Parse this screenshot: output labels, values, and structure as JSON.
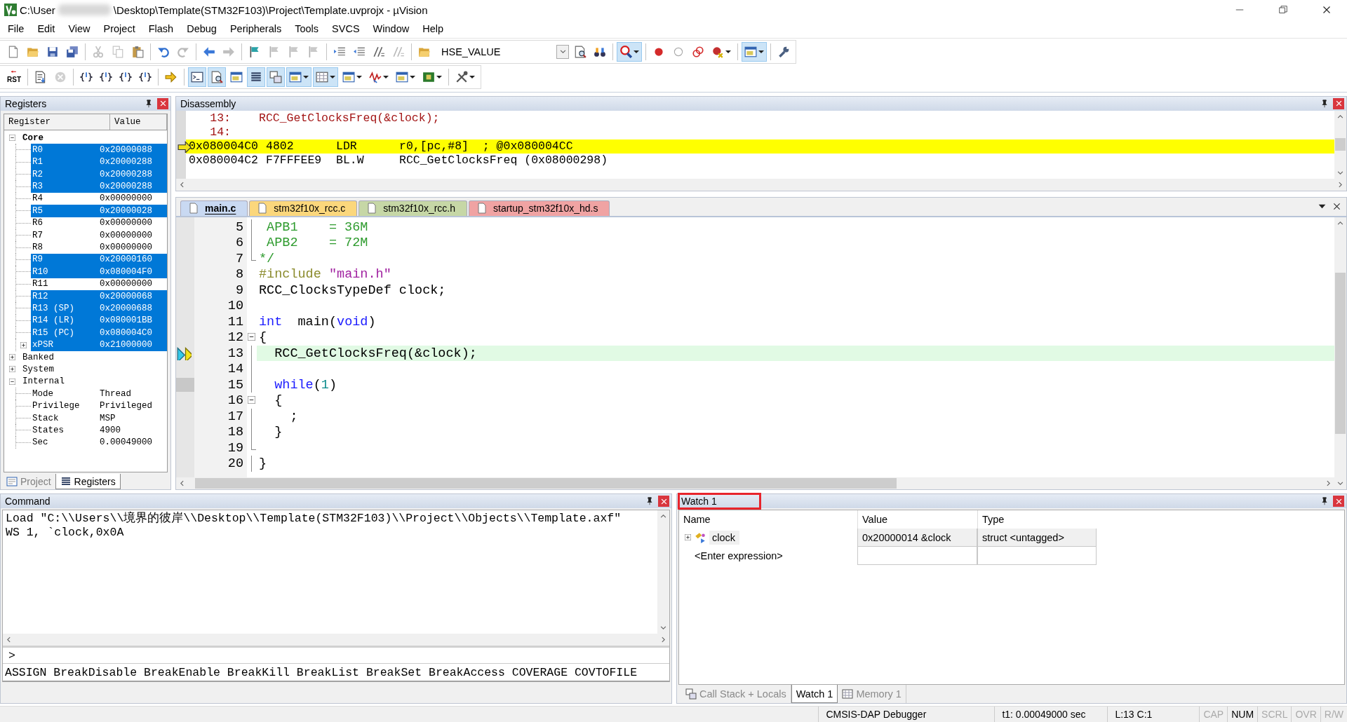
{
  "window": {
    "title_start": "C:\\User",
    "title_end": "\\Desktop\\Template(STM32F103)\\Project\\Template.uvprojx - µVision"
  },
  "menu": [
    "File",
    "Edit",
    "View",
    "Project",
    "Flash",
    "Debug",
    "Peripherals",
    "Tools",
    "SVCS",
    "Window",
    "Help"
  ],
  "toolbar_1": [
    {
      "kind": "button",
      "pressed": false,
      "disabled": false,
      "dropdown": false
    },
    {
      "kind": "button",
      "pressed": false,
      "disabled": false,
      "dropdown": false
    },
    {
      "kind": "button",
      "pressed": false,
      "disabled": false,
      "dropdown": false
    },
    {
      "kind": "button",
      "pressed": false,
      "disabled": false,
      "dropdown": false
    },
    {
      "kind": "separator"
    },
    {
      "kind": "button",
      "pressed": false,
      "disabled": true,
      "dropdown": false
    },
    {
      "kind": "button",
      "pressed": false,
      "disabled": true,
      "dropdown": false
    },
    {
      "kind": "button",
      "pressed": false,
      "disabled": false,
      "dropdown": false
    },
    {
      "kind": "separator"
    },
    {
      "kind": "button",
      "pressed": false,
      "disabled": false,
      "dropdown": false
    },
    {
      "kind": "button",
      "pressed": false,
      "disabled": true,
      "dropdown": false
    },
    {
      "kind": "separator"
    },
    {
      "kind": "button",
      "pressed": false,
      "disabled": false,
      "dropdown": false
    },
    {
      "kind": "button",
      "pressed": false,
      "disabled": true,
      "dropdown": false
    },
    {
      "kind": "separator"
    },
    {
      "kind": "button",
      "pressed": false,
      "disabled": false,
      "dropdown": false
    },
    {
      "kind": "button",
      "pressed": false,
      "disabled": true,
      "dropdown": false
    },
    {
      "kind": "button",
      "pressed": false,
      "disabled": true,
      "dropdown": false
    },
    {
      "kind": "button",
      "pressed": false,
      "disabled": true,
      "dropdown": false
    },
    {
      "kind": "separator"
    },
    {
      "kind": "button",
      "pressed": false,
      "disabled": false,
      "dropdown": false
    },
    {
      "kind": "button",
      "pressed": false,
      "disabled": false,
      "dropdown": false
    },
    {
      "kind": "button",
      "pressed": false,
      "disabled": false,
      "dropdown": false
    },
    {
      "kind": "button",
      "pressed": false,
      "disabled": true,
      "dropdown": false
    },
    {
      "kind": "separator"
    },
    {
      "kind": "button",
      "pressed": false,
      "disabled": false,
      "dropdown": false
    },
    {
      "kind": "combo",
      "value": "HSE_VALUE"
    },
    {
      "kind": "button",
      "pressed": false,
      "disabled": false,
      "dropdown": false
    },
    {
      "kind": "button",
      "pressed": false,
      "disabled": false,
      "dropdown": false
    },
    {
      "kind": "separator"
    },
    {
      "kind": "button",
      "pressed": true,
      "disabled": false,
      "dropdown": true
    },
    {
      "kind": "separator"
    },
    {
      "kind": "button",
      "pressed": false,
      "disabled": false,
      "dropdown": false
    },
    {
      "kind": "button",
      "pressed": false,
      "disabled": false,
      "dropdown": false
    },
    {
      "kind": "button",
      "pressed": false,
      "disabled": false,
      "dropdown": false
    },
    {
      "kind": "button",
      "pressed": false,
      "disabled": false,
      "dropdown": true
    },
    {
      "kind": "separator"
    },
    {
      "kind": "button",
      "pressed": true,
      "disabled": false,
      "dropdown": true
    },
    {
      "kind": "separator"
    },
    {
      "kind": "button",
      "pressed": false,
      "disabled": false,
      "dropdown": false
    }
  ],
  "toolbar_2": [
    {
      "kind": "button",
      "label": "RST",
      "pressed": false,
      "disabled": false,
      "dropdown": false
    },
    {
      "kind": "separator"
    },
    {
      "kind": "button",
      "pressed": false,
      "disabled": false,
      "dropdown": false
    },
    {
      "kind": "button",
      "pressed": false,
      "disabled": true,
      "dropdown": false
    },
    {
      "kind": "separator"
    },
    {
      "kind": "button",
      "pressed": false,
      "disabled": false,
      "dropdown": false
    },
    {
      "kind": "button",
      "pressed": false,
      "disabled": false,
      "dropdown": false
    },
    {
      "kind": "button",
      "pressed": false,
      "disabled": false,
      "dropdown": false
    },
    {
      "kind": "button",
      "pressed": false,
      "disabled": false,
      "dropdown": false
    },
    {
      "kind": "separator"
    },
    {
      "kind": "button",
      "pressed": false,
      "disabled": false,
      "dropdown": false
    },
    {
      "kind": "separator"
    },
    {
      "kind": "button",
      "pressed": true,
      "disabled": false,
      "dropdown": false
    },
    {
      "kind": "button",
      "pressed": true,
      "disabled": false,
      "dropdown": false
    },
    {
      "kind": "button",
      "pressed": false,
      "disabled": false,
      "dropdown": false
    },
    {
      "kind": "button",
      "pressed": true,
      "disabled": false,
      "dropdown": false
    },
    {
      "kind": "button",
      "pressed": true,
      "disabled": false,
      "dropdown": false
    },
    {
      "kind": "button",
      "pressed": true,
      "disabled": false,
      "dropdown": true
    },
    {
      "kind": "button",
      "pressed": true,
      "disabled": false,
      "dropdown": true
    },
    {
      "kind": "button",
      "pressed": false,
      "disabled": false,
      "dropdown": true
    },
    {
      "kind": "button",
      "pressed": false,
      "disabled": false,
      "dropdown": true
    },
    {
      "kind": "button",
      "pressed": false,
      "disabled": false,
      "dropdown": true
    },
    {
      "kind": "button",
      "pressed": false,
      "disabled": false,
      "dropdown": true
    },
    {
      "kind": "separator"
    },
    {
      "kind": "button",
      "pressed": false,
      "disabled": false,
      "dropdown": true
    }
  ],
  "registers": {
    "title": "Registers",
    "columns": [
      "Register",
      "Value"
    ],
    "groups": [
      {
        "label": "Core",
        "bold": true,
        "expanded": true,
        "children": [
          {
            "name": "R0",
            "value": "0x20000088",
            "selected": true
          },
          {
            "name": "R1",
            "value": "0x20000288",
            "selected": true
          },
          {
            "name": "R2",
            "value": "0x20000288",
            "selected": true
          },
          {
            "name": "R3",
            "value": "0x20000288",
            "selected": true
          },
          {
            "name": "R4",
            "value": "0x00000000",
            "selected": false
          },
          {
            "name": "R5",
            "value": "0x20000028",
            "selected": true
          },
          {
            "name": "R6",
            "value": "0x00000000",
            "selected": false
          },
          {
            "name": "R7",
            "value": "0x00000000",
            "selected": false
          },
          {
            "name": "R8",
            "value": "0x00000000",
            "selected": false
          },
          {
            "name": "R9",
            "value": "0x20000160",
            "selected": true
          },
          {
            "name": "R10",
            "value": "0x080004F0",
            "selected": true
          },
          {
            "name": "R11",
            "value": "0x00000000",
            "selected": false
          },
          {
            "name": "R12",
            "value": "0x20000068",
            "selected": true
          },
          {
            "name": "R13 (SP)",
            "value": "0x20000688",
            "selected": true
          },
          {
            "name": "R14 (LR)",
            "value": "0x080001BB",
            "selected": true
          },
          {
            "name": "R15 (PC)",
            "value": "0x080004C0",
            "selected": true
          },
          {
            "name": "xPSR",
            "value": "0x21000000",
            "selected": true,
            "expanded": false
          }
        ]
      },
      {
        "label": "Banked",
        "bold": false,
        "expanded": false
      },
      {
        "label": "System",
        "bold": false,
        "expanded": false
      },
      {
        "label": "Internal",
        "bold": false,
        "expanded": true,
        "children": [
          {
            "name": "Mode",
            "value": "Thread",
            "selected": false
          },
          {
            "name": "Privilege",
            "value": "Privileged",
            "selected": false
          },
          {
            "name": "Stack",
            "value": "MSP",
            "selected": false
          },
          {
            "name": "States",
            "value": "4900",
            "selected": false
          },
          {
            "name": "Sec",
            "value": "0.00049000",
            "selected": false
          }
        ]
      }
    ],
    "tabs": [
      {
        "label": "Project",
        "selected": false
      },
      {
        "label": "Registers",
        "selected": true
      }
    ]
  },
  "disassembly": {
    "title": "Disassembly",
    "lines": [
      {
        "kind": "source",
        "number": "13:",
        "code": "RCC_GetClocksFreq(&clock);",
        "current": false
      },
      {
        "kind": "source",
        "number": "14:",
        "current": false
      },
      {
        "kind": "asm",
        "address": "0x080004C0",
        "opcode": "4802",
        "mnemonic": "LDR",
        "operands": "r0,[pc,#8]  ; @0x080004CC",
        "current": true
      },
      {
        "kind": "asm",
        "address": "0x080004C2",
        "opcode": "F7FFFEE9",
        "mnemonic": "BL.W",
        "operands": "RCC_GetClocksFreq (0x08000298)",
        "current": false
      }
    ]
  },
  "editor": {
    "tabs": [
      {
        "label": "main.c",
        "selected": true,
        "color": "#c9d9f2"
      },
      {
        "label": "stm32f10x_rcc.c",
        "selected": false,
        "color": "#fbd77c"
      },
      {
        "label": "stm32f10x_rcc.h",
        "selected": false,
        "color": "#c6d7a6"
      },
      {
        "label": "startup_stm32f10x_hd.s",
        "selected": false,
        "color": "#f0a3a3"
      }
    ],
    "lines": [
      {
        "number": "5",
        "foldable": false,
        "fold_end": false,
        "executable": false,
        "current": false,
        "tokens": [
          {
            "kind": "comment",
            "text": " APB1    = 36M"
          }
        ]
      },
      {
        "number": "6",
        "foldable": false,
        "fold_end": false,
        "executable": false,
        "current": false,
        "tokens": [
          {
            "kind": "comment",
            "text": " APB2    = 72M"
          }
        ]
      },
      {
        "number": "7",
        "foldable": false,
        "fold_end": true,
        "executable": false,
        "current": false,
        "tokens": [
          {
            "kind": "comment",
            "text": "*/"
          }
        ]
      },
      {
        "number": "8",
        "foldable": false,
        "fold_end": false,
        "executable": false,
        "current": false,
        "tokens": [
          {
            "kind": "preprocessor",
            "text": "#include "
          },
          {
            "kind": "string",
            "text": "\"main.h\""
          }
        ]
      },
      {
        "number": "9",
        "foldable": false,
        "fold_end": false,
        "executable": false,
        "current": false,
        "tokens": [
          {
            "kind": "plain",
            "text": "RCC_ClocksTypeDef clock;"
          }
        ]
      },
      {
        "number": "10",
        "foldable": false,
        "fold_end": false,
        "executable": false,
        "current": false
      },
      {
        "number": "11",
        "foldable": false,
        "fold_end": false,
        "executable": false,
        "current": false,
        "tokens": [
          {
            "kind": "keyword",
            "text": "int"
          },
          {
            "kind": "plain",
            "text": "  main("
          },
          {
            "kind": "keyword",
            "text": "void"
          },
          {
            "kind": "plain",
            "text": ")"
          }
        ]
      },
      {
        "number": "12",
        "foldable": true,
        "fold_end": false,
        "executable": false,
        "current": false,
        "tokens": [
          {
            "kind": "plain",
            "text": "{"
          }
        ]
      },
      {
        "number": "13",
        "foldable": false,
        "fold_end": false,
        "executable": true,
        "current": true,
        "tokens": [
          {
            "kind": "plain",
            "text": "  RCC_GetClocksFreq(&clock);"
          }
        ]
      },
      {
        "number": "14",
        "foldable": false,
        "fold_end": false,
        "executable": false,
        "current": false
      },
      {
        "number": "15",
        "foldable": false,
        "fold_end": false,
        "executable": true,
        "current": false,
        "tokens": [
          {
            "kind": "keyword",
            "text": "  while"
          },
          {
            "kind": "plain",
            "text": "("
          },
          {
            "kind": "number",
            "text": "1"
          },
          {
            "kind": "plain",
            "text": ")"
          }
        ]
      },
      {
        "number": "16",
        "foldable": true,
        "fold_end": false,
        "executable": false,
        "current": false,
        "tokens": [
          {
            "kind": "plain",
            "text": "  {"
          }
        ]
      },
      {
        "number": "17",
        "foldable": false,
        "fold_end": false,
        "executable": false,
        "current": false,
        "tokens": [
          {
            "kind": "plain",
            "text": "    ;"
          }
        ]
      },
      {
        "number": "18",
        "foldable": false,
        "fold_end": false,
        "executable": false,
        "current": false,
        "tokens": [
          {
            "kind": "plain",
            "text": "  }"
          }
        ]
      },
      {
        "number": "19",
        "foldable": false,
        "fold_end": true,
        "executable": false,
        "current": false
      },
      {
        "number": "20",
        "foldable": false,
        "fold_end": false,
        "executable": false,
        "current": false,
        "tokens": [
          {
            "kind": "plain",
            "text": "}"
          }
        ]
      }
    ]
  },
  "command": {
    "title": "Command",
    "output": [
      "Load \"C:\\\\Users\\\\境界的彼岸\\\\Desktop\\\\Template(STM32F103)\\\\Project\\\\Objects\\\\Template.axf\"",
      "WS 1, `clock,0x0A"
    ],
    "prompt": ">",
    "commands": "ASSIGN BreakDisable BreakEnable BreakKill BreakList BreakSet BreakAccess COVERAGE COVTOFILE"
  },
  "watch": {
    "title": "Watch 1",
    "annotated": true,
    "columns": [
      "Name",
      "Value",
      "Type"
    ],
    "rows": [
      {
        "kind": "variable",
        "name": "clock",
        "value": "0x20000014 &clock",
        "type": "struct <untagged>",
        "expanded": false
      },
      {
        "kind": "entry",
        "name": "<Enter expression>"
      }
    ],
    "tabs": [
      {
        "label": "Call Stack + Locals",
        "selected": false
      },
      {
        "label": "Watch 1",
        "selected": true
      },
      {
        "label": "Memory 1",
        "selected": false
      }
    ]
  },
  "status_bar": {
    "debugger": "CMSIS-DAP Debugger",
    "time": "t1: 0.00049000 sec",
    "position": "L:13 C:1",
    "indicators": [
      {
        "label": "CAP",
        "on": false
      },
      {
        "label": "NUM",
        "on": true
      },
      {
        "label": "SCRL",
        "on": false
      },
      {
        "label": "OVR",
        "on": false
      },
      {
        "label": "R/W",
        "on": false
      }
    ]
  }
}
